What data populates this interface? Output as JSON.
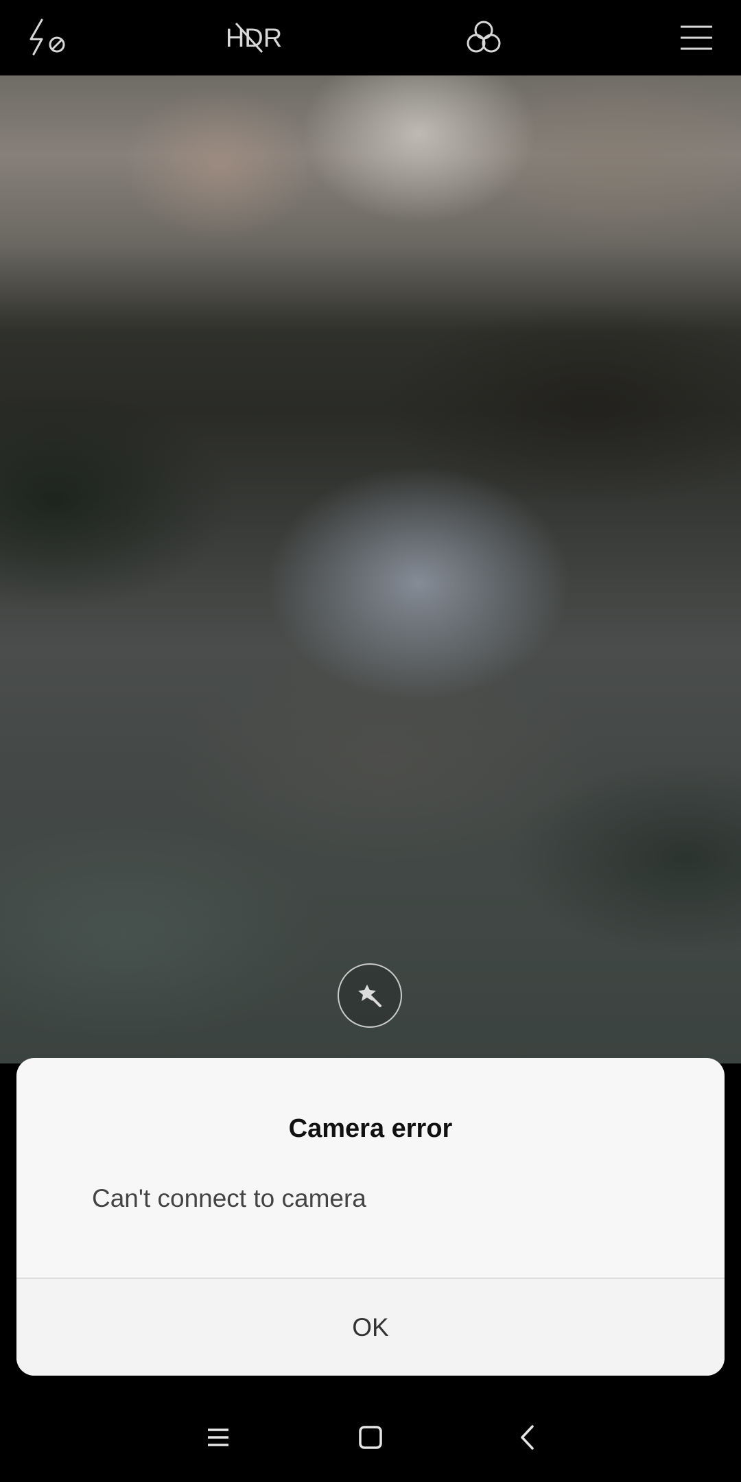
{
  "top_bar": {
    "icons": [
      "flash-off-icon",
      "hdr-off-icon",
      "filters-icon",
      "menu-icon"
    ],
    "hdr_text": "HDR",
    "icon_color": "#d8d8d8"
  },
  "viewfinder": {
    "assist_icon": "magic-wand-icon"
  },
  "dialog": {
    "title": "Camera error",
    "message": "Can't connect to camera",
    "ok_label": "OK"
  },
  "nav_bar": {
    "icons": [
      "recents-icon",
      "home-icon",
      "back-icon"
    ],
    "icon_color": "#e6e6e6"
  }
}
